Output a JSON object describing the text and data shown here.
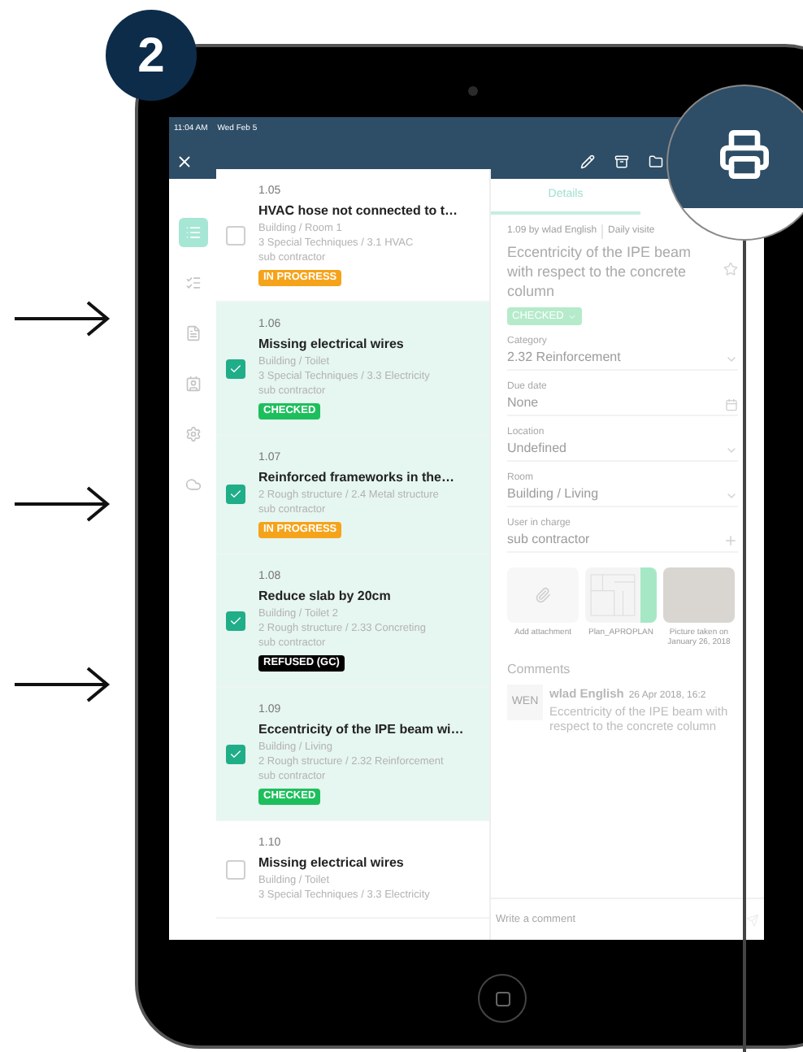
{
  "step_badge": "2",
  "status_bar": {
    "time": "11:04 AM",
    "date": "Wed Feb 5"
  },
  "sidebar": [
    {
      "selected": true
    },
    {
      "selected": false
    },
    {
      "selected": false
    },
    {
      "selected": false
    },
    {
      "selected": false
    },
    {
      "selected": false
    }
  ],
  "issues": [
    {
      "number": "1.05",
      "title": "HVAC hose not connected to t…",
      "location": "Building / Room 1",
      "category": "3 Special Techniques / 3.1 HVAC",
      "assignee": "sub contractor",
      "status": "IN PROGRESS",
      "color": "#f5a31a",
      "checked": false,
      "selected": false
    },
    {
      "number": "1.06",
      "title": "Missing electrical wires",
      "location": "Building / Toilet",
      "category": "3 Special Techniques / 3.3 Electricity",
      "assignee": "sub contractor",
      "status": "CHECKED",
      "color": "#1dbf5c",
      "checked": true,
      "selected": true
    },
    {
      "number": "1.07",
      "title": "Reinforced frameworks in the…",
      "category": "2 Rough structure / 2.4 Metal structure",
      "assignee": "sub contractor",
      "status": "IN PROGRESS",
      "color": "#f5a31a",
      "checked": true,
      "selected": true
    },
    {
      "number": "1.08",
      "title": "Reduce slab by 20cm",
      "location": "Building / Toilet 2",
      "category": "2 Rough structure / 2.33 Concreting",
      "assignee": "sub contractor",
      "status": "REFUSED (GC)",
      "color": "#000000",
      "checked": true,
      "selected": true
    },
    {
      "number": "1.09",
      "title": "Eccentricity of the IPE beam wi…",
      "location": "Building / Living",
      "category": "2 Rough structure / 2.32 Reinforcement",
      "assignee": "sub contractor",
      "status": "CHECKED",
      "color": "#1dbf5c",
      "checked": true,
      "selected": true
    },
    {
      "number": "1.10",
      "title": "Missing electrical wires",
      "location": "Building / Toilet",
      "category": "3 Special Techniques / 3.3 Electricity",
      "checked": false,
      "selected": false
    }
  ],
  "detail": {
    "tabs": [
      {
        "label": "Details",
        "selected": true
      }
    ],
    "meta": "1.09 by wlad English",
    "meta_tag": "Daily visite",
    "title": "Eccentricity of the IPE beam with respect to the concrete column",
    "starred": false,
    "status": "CHECKED",
    "fields": [
      {
        "label": "Category",
        "value": "2.32 Reinforcement",
        "kind": "select"
      },
      {
        "label": "Due date",
        "value": "None",
        "kind": "date"
      },
      {
        "label": "Location",
        "value": "Undefined",
        "kind": "select"
      },
      {
        "label": "Room",
        "value": "Building / Living",
        "kind": "select"
      },
      {
        "label": "User in charge",
        "value": "sub contractor",
        "kind": "add"
      }
    ],
    "attachments": [
      {
        "kind": "add",
        "caption": "Add attachment"
      },
      {
        "kind": "plan",
        "caption": "Plan_APROPLAN"
      },
      {
        "kind": "photo",
        "caption": "Picture taken on January 26, 2018"
      }
    ],
    "comments_heading": "Comments",
    "comments": [
      {
        "initials": "WEN",
        "author": "wlad English",
        "date": "26 Apr 2018, 16:2",
        "text": "Eccentricity of the IPE beam with respect to the concrete column"
      }
    ],
    "comment_placeholder": "Write a comment"
  }
}
